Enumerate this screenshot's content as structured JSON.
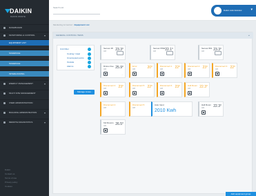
{
  "brand": {
    "name": "DAIKIN",
    "subtitle": "DAIKIN ONSITE"
  },
  "header": {
    "search_label": "Search unit",
    "search_placeholder": "",
    "user_name": "Daikin Administrator"
  },
  "sidebar": {
    "items": [
      {
        "label": "DASHBOARD"
      },
      {
        "label": "MONITORING & CONTROL"
      },
      {
        "label": "EQUIPMENT LIST"
      },
      {
        "label": "SCHEDULE"
      },
      {
        "label": "SCHEDULE"
      },
      {
        "label": "INTERLOCKING"
      },
      {
        "label": "ENERGY MANAGEMENT"
      },
      {
        "label": "MULTI SITE MANAGEMENT"
      },
      {
        "label": "USER ADMINISTRATION"
      },
      {
        "label": "BUILDING ADMINISTRATION"
      },
      {
        "label": "REMOTE DIAGNOSTICS"
      }
    ],
    "footer": [
      "Daikin",
      "Contact us",
      "Terms of use",
      "Privacy policy",
      "Cookies"
    ]
  },
  "breadcrumb": {
    "path": "Monitoring & Control  >",
    "current": "Equipment List"
  },
  "panel": {
    "title": "GENERAL CONTROL ITEMS"
  },
  "filter": {
    "items": [
      "Unit Filter",
      "Cooling / Heat",
      "Unoccupied points",
      "Outside",
      "Alarms"
    ]
  },
  "manage_button": "Manage zones",
  "cards": [
    {
      "title": "Sensor 28",
      "sub": "Off",
      "temp": "23.3°"
    },
    {
      "title": "Sensor PINE",
      "sub": "Off",
      "temp": "22.1°"
    },
    {
      "title": "Sensor 801",
      "sub": "Off",
      "temp": "23.3°"
    },
    {
      "title": "Dinner Ave",
      "sub": "Off",
      "temp": "25.9°"
    },
    {
      "title": "Error",
      "sub": "Off",
      "temp": "20°"
    },
    {
      "title": "Disconnect 1",
      "sub": "Off",
      "temp": "22°"
    },
    {
      "title": "Disconnect 2",
      "sub": "Off",
      "temp": "23°"
    },
    {
      "title": "Disconnect 3",
      "sub": "Off",
      "temp": "22°"
    },
    {
      "title": "Disconnect 4",
      "sub": "Off",
      "temp": "23°"
    },
    {
      "title": "Disconnect 5",
      "sub": "Off",
      "temp": "22°"
    },
    {
      "title": "Disconnect 6",
      "sub": "Off",
      "temp": "23°"
    },
    {
      "title": "Hall Room",
      "sub": "Off",
      "temp": "22.3°"
    },
    {
      "title": "Kid Rooms",
      "sub": "Off",
      "temp": "26.5°"
    }
  ],
  "energy_card": {
    "title": "Auto Input",
    "value": "2010 Kwh"
  },
  "bottom_button": "Add equipment group",
  "colors": {
    "sidebar": "#252b31",
    "accent": "#1e6db5",
    "warning": "#f5a623",
    "info": "#1e8fe0"
  }
}
